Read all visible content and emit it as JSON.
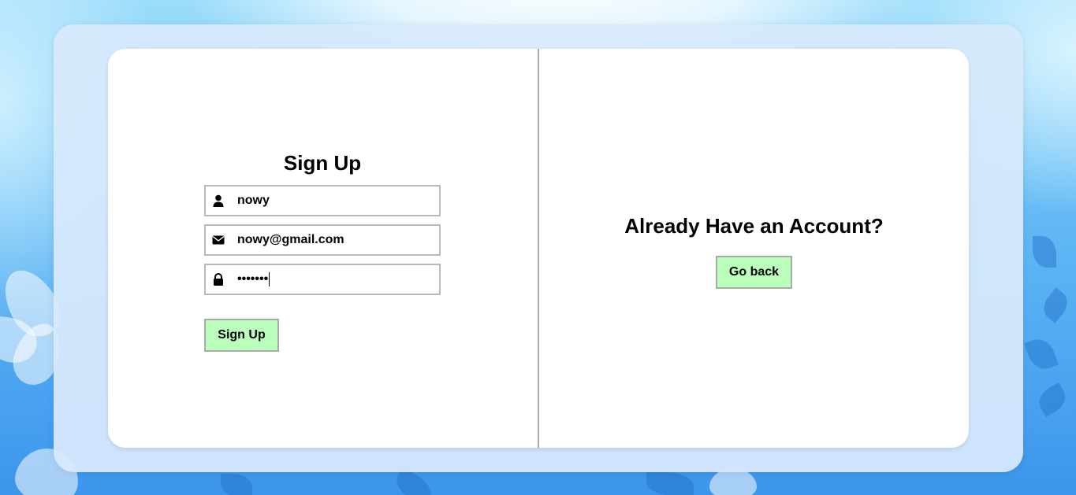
{
  "signup": {
    "title": "Sign Up",
    "username_value": "nowy",
    "email_value": "nowy@gmail.com",
    "password_masked": "•••••••",
    "submit_label": "Sign Up"
  },
  "login_prompt": {
    "title": "Already Have an Account?",
    "button_label": "Go back"
  },
  "icons": {
    "username": "user-icon",
    "email": "envelope-icon",
    "password": "lock-icon"
  },
  "colors": {
    "button_bg": "#bbfdbb",
    "card_bg": "#ffffff",
    "frame_bg": "#d8e9fd"
  }
}
